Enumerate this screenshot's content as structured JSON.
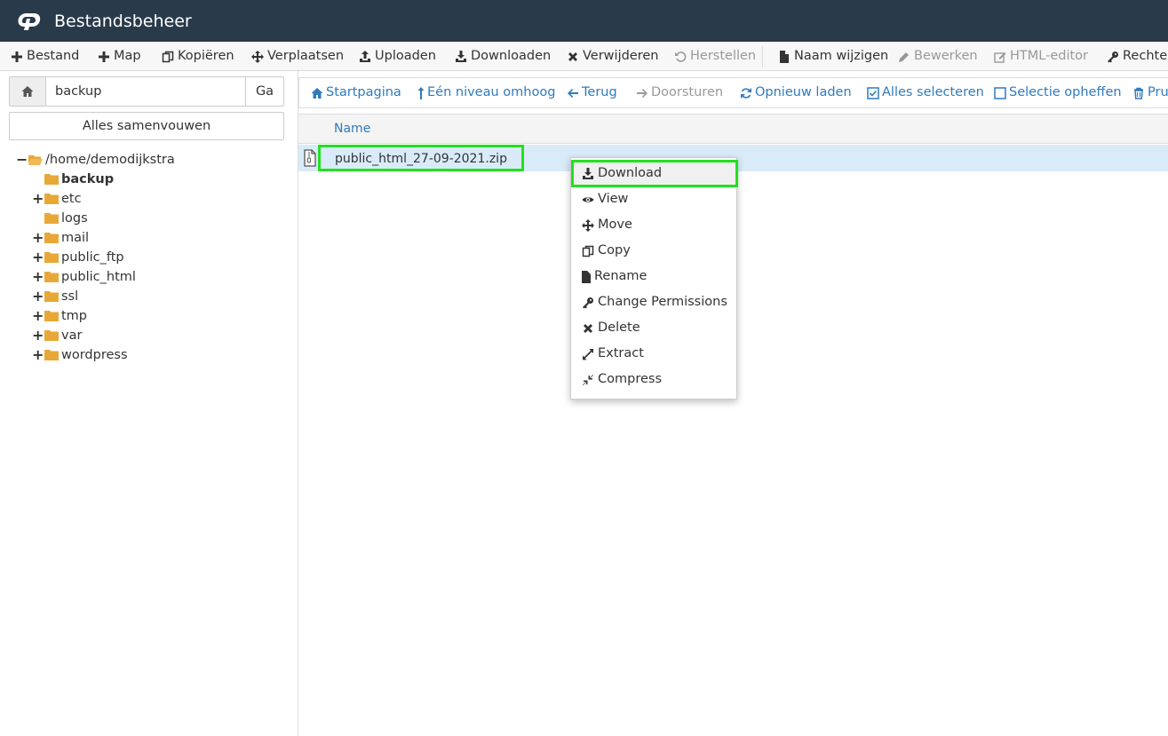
{
  "header": {
    "title": "Bestandsbeheer"
  },
  "toolbar": {
    "items": [
      {
        "label": "Bestand",
        "icon": "plus-icon",
        "disabled": false
      },
      {
        "label": "Map",
        "icon": "plus-icon",
        "disabled": false
      },
      {
        "label": "Kopiëren",
        "icon": "copy-icon",
        "disabled": false
      },
      {
        "label": "Verplaatsen",
        "icon": "move-icon",
        "disabled": false
      },
      {
        "label": "Uploaden",
        "icon": "upload-icon",
        "disabled": false
      },
      {
        "label": "Downloaden",
        "icon": "download-icon",
        "disabled": false
      },
      {
        "label": "Verwijderen",
        "icon": "delete-icon",
        "disabled": false
      },
      {
        "label": "Herstellen",
        "icon": "undo-icon",
        "disabled": true
      },
      {
        "label": "Naam wijzigen",
        "icon": "file-icon",
        "disabled": false
      },
      {
        "label": "Bewerken",
        "icon": "pencil-icon",
        "disabled": true
      },
      {
        "label": "HTML-editor",
        "icon": "edit-icon",
        "disabled": true
      },
      {
        "label": "Rechten",
        "icon": "key-icon",
        "disabled": false
      }
    ]
  },
  "sidebar": {
    "path_value": "backup",
    "go_label": "Ga",
    "collapse_label": "Alles samenvouwen",
    "tree": {
      "root": "/home/demodijkstra",
      "items": [
        {
          "label": "backup",
          "expandable": false,
          "bold": true
        },
        {
          "label": "etc",
          "expandable": true,
          "bold": false
        },
        {
          "label": "logs",
          "expandable": false,
          "bold": false
        },
        {
          "label": "mail",
          "expandable": true,
          "bold": false
        },
        {
          "label": "public_ftp",
          "expandable": true,
          "bold": false
        },
        {
          "label": "public_html",
          "expandable": true,
          "bold": false
        },
        {
          "label": "ssl",
          "expandable": true,
          "bold": false
        },
        {
          "label": "tmp",
          "expandable": true,
          "bold": false
        },
        {
          "label": "var",
          "expandable": true,
          "bold": false
        },
        {
          "label": "wordpress",
          "expandable": true,
          "bold": false
        }
      ]
    }
  },
  "navbar": {
    "items": [
      {
        "label": "Startpagina",
        "icon": "home-icon",
        "disabled": false
      },
      {
        "label": "Eén niveau omhoog",
        "icon": "level-up-icon",
        "disabled": false
      },
      {
        "label": "Terug",
        "icon": "arrow-left-icon",
        "disabled": false
      },
      {
        "label": "Doorsturen",
        "icon": "arrow-right-icon",
        "disabled": true
      },
      {
        "label": "Opnieuw laden",
        "icon": "refresh-icon",
        "disabled": false
      },
      {
        "label": "Alles selecteren",
        "icon": "checkbox-checked-icon",
        "disabled": false
      },
      {
        "label": "Selectie opheffen",
        "icon": "checkbox-empty-icon",
        "disabled": false
      },
      {
        "label": "Pru",
        "icon": "trash-icon",
        "disabled": false
      }
    ]
  },
  "table": {
    "column_name": "Name",
    "rows": [
      {
        "name": "public_html_27-09-2021.zip"
      }
    ]
  },
  "context_menu": {
    "items": [
      {
        "label": "Download",
        "icon": "download-icon"
      },
      {
        "label": "View",
        "icon": "eye-icon"
      },
      {
        "label": "Move",
        "icon": "move-icon"
      },
      {
        "label": "Copy",
        "icon": "copy-icon"
      },
      {
        "label": "Rename",
        "icon": "file-icon"
      },
      {
        "label": "Change Permissions",
        "icon": "key-icon"
      },
      {
        "label": "Delete",
        "icon": "delete-icon"
      },
      {
        "label": "Extract",
        "icon": "expand-icon"
      },
      {
        "label": "Compress",
        "icon": "compress-icon"
      }
    ]
  },
  "colors": {
    "header_bg": "#293a4a",
    "link": "#2f7bbd",
    "folder": "#e8a838",
    "highlight": "#22e01e",
    "selected_row": "#d9ebf8"
  }
}
